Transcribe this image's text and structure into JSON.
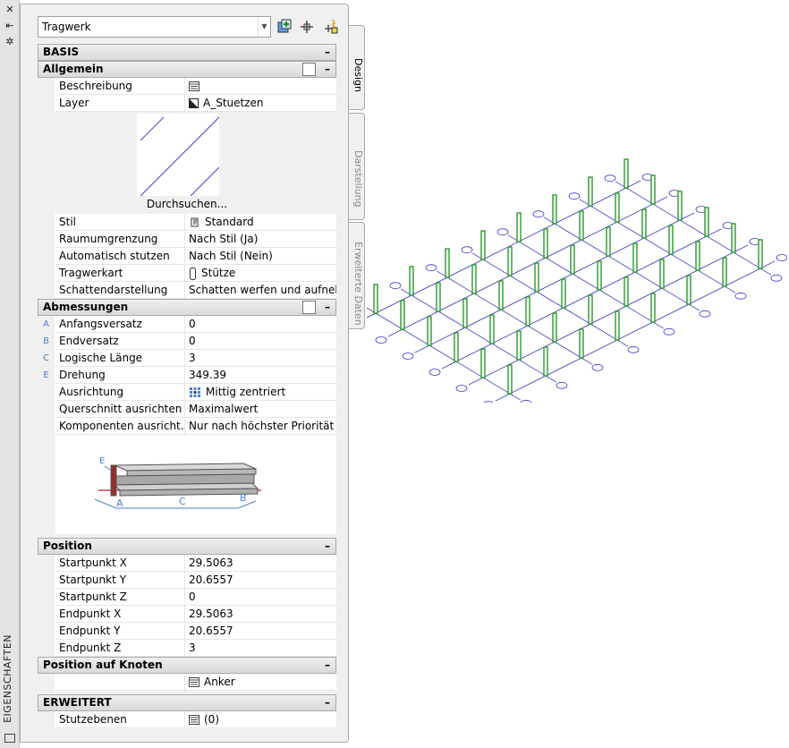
{
  "titlebar": {
    "title": "EIGENSCHAFTEN",
    "close": "✕",
    "autohide": "⇤",
    "props": "✲"
  },
  "dropdown": {
    "value": "Tragwerk"
  },
  "tabs": [
    "Design",
    "Darstellung",
    "Erweiterte Daten"
  ],
  "basis": {
    "label": "BASIS"
  },
  "allgemein": {
    "label": "Allgemein",
    "rows": [
      {
        "name": "Beschreibung",
        "value": ""
      },
      {
        "name": "Layer",
        "value": "A_Stuetzen"
      }
    ],
    "browse": "Durchsuchen...",
    "rows2": [
      {
        "name": "Stil",
        "value": "Standard"
      },
      {
        "name": "Raumumgrenzung",
        "value": "Nach Stil (Ja)"
      },
      {
        "name": "Automatisch stutzen",
        "value": "Nach Stil (Nein)"
      },
      {
        "name": "Tragwerkart",
        "value": "Stütze"
      },
      {
        "name": "Schattendarstellung",
        "value": "Schatten werfen und aufneh..."
      }
    ]
  },
  "abmessungen": {
    "label": "Abmessungen",
    "rows": [
      {
        "key": "A",
        "name": "Anfangsversatz",
        "value": "0"
      },
      {
        "key": "B",
        "name": "Endversatz",
        "value": "0"
      },
      {
        "key": "C",
        "name": "Logische Länge",
        "value": "3"
      },
      {
        "key": "E",
        "name": "Drehung",
        "value": "349.39"
      },
      {
        "key": "",
        "name": "Ausrichtung",
        "value": "Mittig zentriert"
      },
      {
        "key": "",
        "name": "Querschnitt ausrichten",
        "value": "Maximalwert"
      },
      {
        "key": "",
        "name": "Komponenten  ausricht...",
        "value": "Nur nach höchster Priorität"
      }
    ],
    "diagram_labels": {
      "e": "E",
      "a": "A",
      "c": "C",
      "b": "B"
    }
  },
  "position": {
    "label": "Position",
    "rows": [
      {
        "name": "Startpunkt X",
        "value": "29.5063"
      },
      {
        "name": "Startpunkt Y",
        "value": "20.6557"
      },
      {
        "name": "Startpunkt Z",
        "value": "0"
      },
      {
        "name": "Endpunkt X",
        "value": "29.5063"
      },
      {
        "name": "Endpunkt Y",
        "value": "20.6557"
      },
      {
        "name": "Endpunkt Z",
        "value": "3"
      }
    ]
  },
  "knoten": {
    "label": "Position auf Knoten",
    "value": "Anker"
  },
  "erweitert": {
    "label": "ERWEITERT",
    "rows": [
      {
        "name": "Stutzebenen",
        "value": "(0)"
      }
    ]
  },
  "minus": "–",
  "colors": {
    "column": "#2a9a2a",
    "grid": "#3a3ad0",
    "accent": "#4a7fd6"
  }
}
